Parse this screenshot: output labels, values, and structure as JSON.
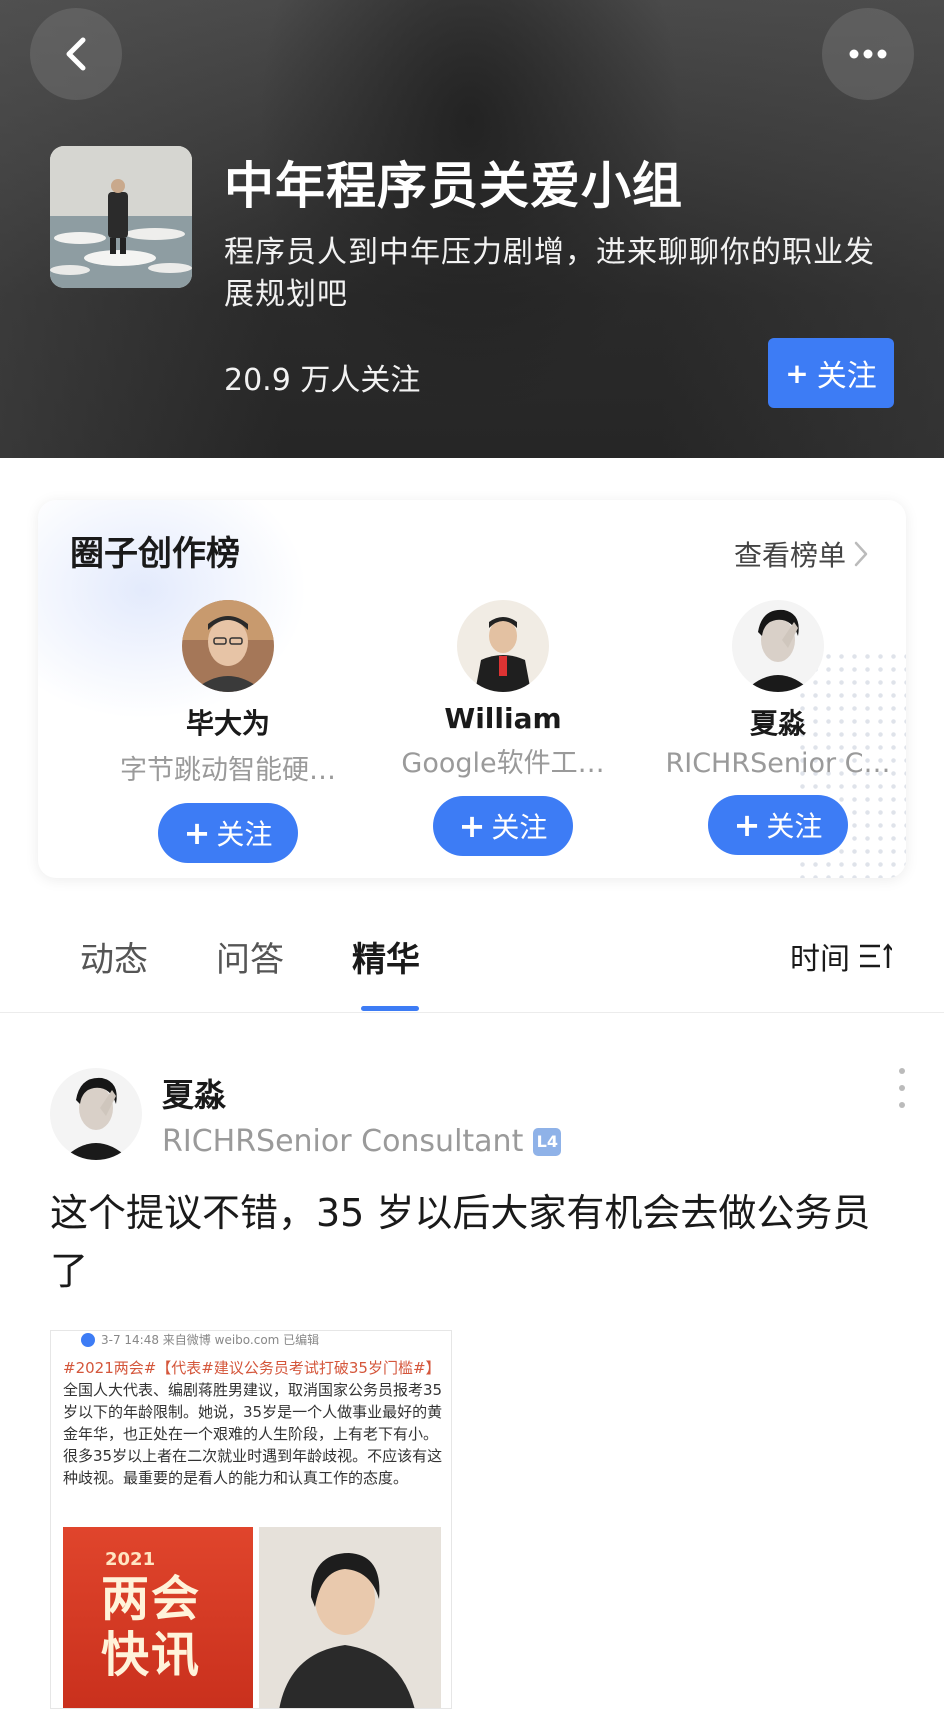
{
  "header": {
    "title": "中年程序员关爱小组",
    "description": "程序员人到中年压力剧增，进来聊聊你的职业发展规划吧",
    "followers": "20.9 万人关注",
    "follow_label": "关注",
    "follow_plus": "+"
  },
  "board": {
    "title": "圈子创作榜",
    "more_label": "查看榜单",
    "creators": [
      {
        "name": "毕大为",
        "title": "字节跳动智能硬…",
        "follow_label": "关注"
      },
      {
        "name": "William",
        "title": "Google软件工…",
        "follow_label": "关注"
      },
      {
        "name": "夏淼",
        "title": "RICHRSenior C…",
        "follow_label": "关注"
      }
    ]
  },
  "tabs": {
    "items": [
      {
        "label": "动态"
      },
      {
        "label": "问答"
      },
      {
        "label": "精华"
      }
    ],
    "active_index": 2,
    "sort_label": "时间"
  },
  "post": {
    "author": "夏淼",
    "subtitle": "RICHRSenior Consultant",
    "level_badge": "L4",
    "text": "这个提议不错，35 岁以后大家有机会去做公务员了",
    "image": {
      "meta": "3-7 14:48  来自微博 weibo.com  已编辑",
      "tag": "#2021两会#【代表#建议公务员考试打破35岁门槛#】",
      "body": "全国人大代表、编剧蒋胜男建议，取消国家公务员报考35岁以下的年龄限制。她说，35岁是一个人做事业最好的黄金年华，也正处在一个艰难的人生阶段，上有老下有小。很多35岁以上者在二次就业时遇到年龄歧视。不应该有这种歧视。最重要的是看人的能力和认真工作的态度。",
      "badge_year": "2021",
      "badge_text": "两会快讯"
    }
  },
  "colors": {
    "accent": "#3d7cf5",
    "muted_text": "#9a9a9a"
  }
}
